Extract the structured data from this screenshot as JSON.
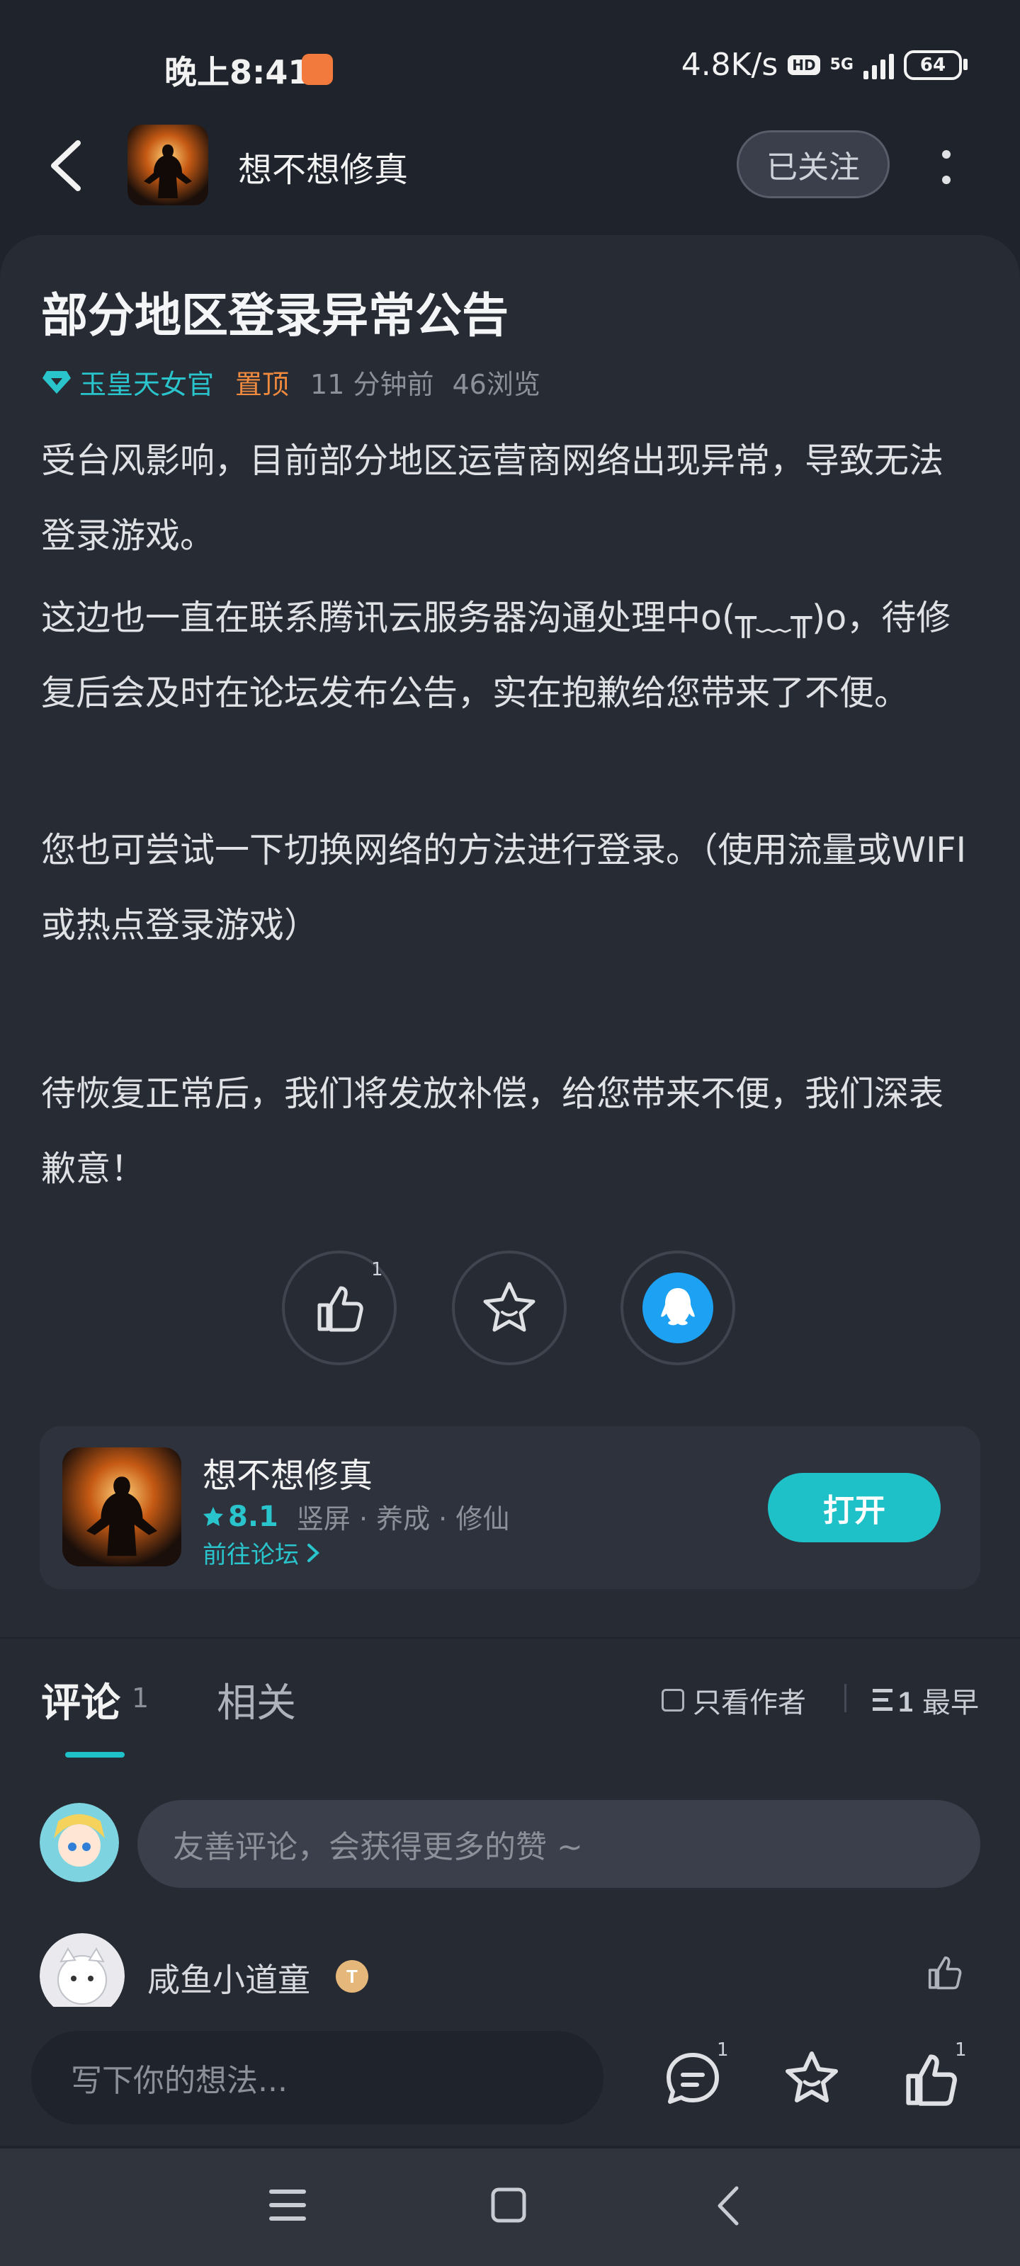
{
  "status_bar": {
    "time": "晚上8:41",
    "net_speed": "4.8K/s",
    "hd": "HD",
    "network": "5G",
    "battery": "64"
  },
  "header": {
    "title": "想不想修真",
    "follow_label": "已关注"
  },
  "article": {
    "title": "部分地区登录异常公告",
    "author": "玉皇天女官",
    "pinned": "置顶",
    "time_ago": "11 分钟前",
    "views": "46浏览",
    "paragraphs": [
      "受台风影响，目前部分地区运营商网络出现异常，导致无法登录游戏。",
      "这边也一直在联系腾讯云服务器沟通处理中o(╥﹏╥)o，待修复后会及时在论坛发布公告，实在抱歉给您带来了不便。",
      "您也可尝试一下切换网络的方法进行登录。（使用流量或WIFI或热点登录游戏）",
      "待恢复正常后，我们将发放补偿，给您带来不便，我们深表歉意！"
    ],
    "like_count": "1"
  },
  "game_card": {
    "name": "想不想修真",
    "rating": "8.1",
    "tags": "竖屏 · 养成 · 修仙",
    "forum_link": "前往论坛",
    "open_label": "打开"
  },
  "comments": {
    "tab_comment": "评论",
    "comment_count": "1",
    "tab_related": "相关",
    "author_only": "只看作者",
    "sort_label": "最早",
    "input_placeholder": "友善评论，会获得更多的赞 ~",
    "first_comment_user": "咸鱼小道童"
  },
  "bottom_bar": {
    "placeholder": "写下你的想法...",
    "comment_count": "1",
    "like_count": "1"
  },
  "colors": {
    "accent": "#1fc1c8",
    "pinned": "#f08a3e",
    "background": "#1f232c"
  }
}
